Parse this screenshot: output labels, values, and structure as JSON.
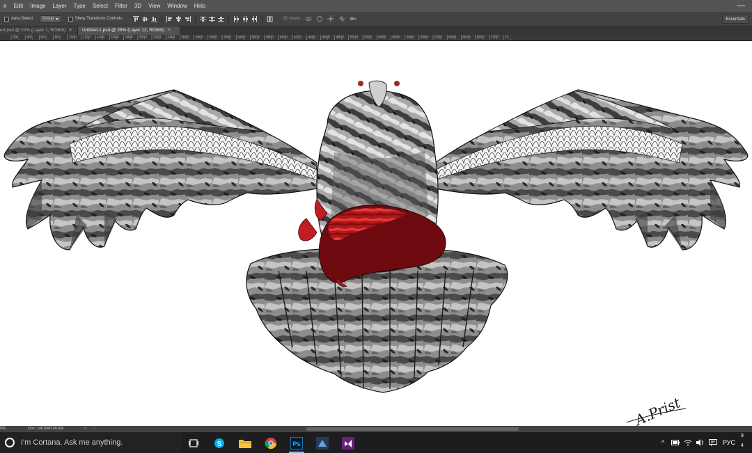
{
  "menu": {
    "items": [
      "e",
      "Edit",
      "Image",
      "Layer",
      "Type",
      "Select",
      "Filter",
      "3D",
      "View",
      "Window",
      "Help"
    ]
  },
  "options": {
    "auto_select_label": "Auto-Select:",
    "group_value": "Group",
    "show_transform_label": "Show Transform Controls",
    "mode_3d_label": "3D Mode:",
    "essentials_label": "Essentials"
  },
  "tabs": [
    {
      "label": "ert.psd @ 20% (Layer 1, RGB/8)",
      "close": "×"
    },
    {
      "label": "Untitled-1.psd @ 25% (Layer 12, RGB/8)",
      "close": "×"
    }
  ],
  "ruler": {
    "labels": [
      "200",
      "400",
      "600",
      "800",
      "1000",
      "1200",
      "1400",
      "1600",
      "1800",
      "2000",
      "2200",
      "2400",
      "2600",
      "2800",
      "3000",
      "3200",
      "3400",
      "3600",
      "3800",
      "4000",
      "4200",
      "4400",
      "4600",
      "4800",
      "5000",
      "5200",
      "5400",
      "5600",
      "5800",
      "6000",
      "6200",
      "6400",
      "6600",
      "6800",
      "7000",
      "72"
    ]
  },
  "canvas": {
    "signature_text": "A.Prist"
  },
  "status": {
    "zoom": "5%",
    "doc": "Doc: 140.8M/126.6M",
    "arrow": "›",
    "scroll_left": "‹"
  },
  "taskbar": {
    "search_placeholder": "I'm Cortana. Ask me anything.",
    "apps": [
      "task-view",
      "skype",
      "file-explorer",
      "chrome",
      "photoshop",
      "app-blue",
      "visual-studio"
    ],
    "lang": "РУС",
    "clock_line1": "9",
    "clock_line2": "4"
  },
  "colors": {
    "menubar": "#535353",
    "optbar": "#424242",
    "canvas_bg": "#ffffff",
    "heart_red": "#b01818",
    "taskbar": "#1d1d1f"
  }
}
